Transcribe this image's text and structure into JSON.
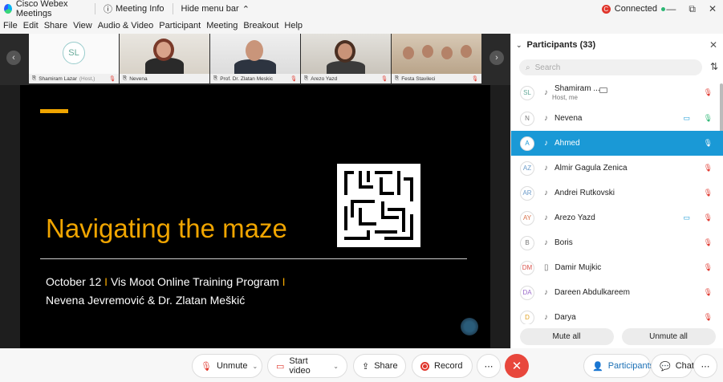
{
  "titlebar": {
    "app_name": "Cisco Webex Meetings",
    "meeting_info": "Meeting Info",
    "hide_menu": "Hide menu bar",
    "status": "Connected"
  },
  "menu": [
    "File",
    "Edit",
    "Share",
    "View",
    "Audio & Video",
    "Participant",
    "Meeting",
    "Breakout",
    "Help"
  ],
  "filmstrip": [
    {
      "name": "Shamiram Lazar",
      "suffix": "(Host,)",
      "initials": "SL"
    },
    {
      "name": "Nevena"
    },
    {
      "name": "Prof. Dr. Zlatan Meskic"
    },
    {
      "name": "Arezo Yazd"
    },
    {
      "name": "Festa Stavileci"
    }
  ],
  "slide": {
    "title": "Navigating the maze",
    "line1_a": "October 12",
    "line1_b": "Vis Moot Online Training Program",
    "line2": "Nevena Jevremović & Dr. Zlatan Meškić",
    "pipe": "I"
  },
  "panel": {
    "title": "Participants (33)",
    "search_placeholder": "Search",
    "participants": [
      {
        "initials": "SL",
        "name": "Shamiram ...",
        "sub": "Host, me"
      },
      {
        "initials": "N",
        "name": "Nevena"
      },
      {
        "initials": "A",
        "name": "Ahmed"
      },
      {
        "initials": "AZ",
        "name": "Almir Gagula Zenica"
      },
      {
        "initials": "AR",
        "name": "Andrei Rutkovski"
      },
      {
        "initials": "AY",
        "name": "Arezo Yazd"
      },
      {
        "initials": "B",
        "name": "Boris"
      },
      {
        "initials": "DM",
        "name": "Damir Mujkic"
      },
      {
        "initials": "DA",
        "name": "Dareen Abdulkareem"
      },
      {
        "initials": "D",
        "name": "Darya"
      }
    ],
    "mute_all": "Mute all",
    "unmute_all": "Unmute all"
  },
  "toolbar": {
    "unmute": "Unmute",
    "start_video": "Start video",
    "share": "Share",
    "record": "Record",
    "participants": "Participants",
    "chat": "Chat"
  },
  "colors": {
    "accent": "#1a99d6",
    "slide_accent": "#f0a500",
    "end": "#e8473c"
  }
}
